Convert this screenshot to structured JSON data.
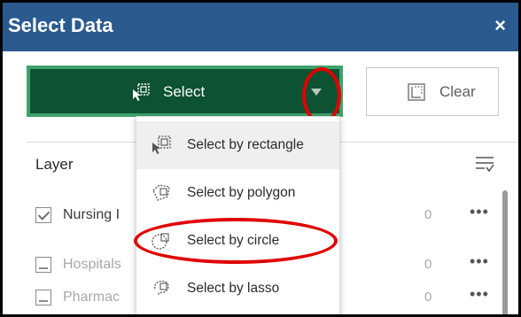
{
  "dialog": {
    "title": "Select Data",
    "close_label": "×"
  },
  "toolbar": {
    "select_label": "Select",
    "clear_label": "Clear"
  },
  "layer_list": {
    "header": "Layer",
    "rows": [
      {
        "name": "Nursing Homes",
        "visible_name": "Nursing I",
        "count": "0",
        "checked": true
      },
      {
        "name": "Hospitals",
        "visible_name": "Hospitals",
        "count": "0",
        "checked": false
      },
      {
        "name": "Pharmacies",
        "visible_name": "Pharmac",
        "count": "0",
        "checked": false
      }
    ],
    "more_label": "•••"
  },
  "select_menu": {
    "items": [
      {
        "label": "Select by rectangle",
        "icon": "select-rectangle-icon",
        "active": true
      },
      {
        "label": "Select by polygon",
        "icon": "select-polygon-icon",
        "active": false
      },
      {
        "label": "Select by circle",
        "icon": "select-circle-icon",
        "active": false
      },
      {
        "label": "Select by lasso",
        "icon": "select-lasso-icon",
        "active": false
      }
    ]
  },
  "colors": {
    "titlebar": "#2a5a8e",
    "select_button": "#0d5232",
    "select_button_border": "#3ea26a",
    "highlight_ring": "#e00000"
  }
}
